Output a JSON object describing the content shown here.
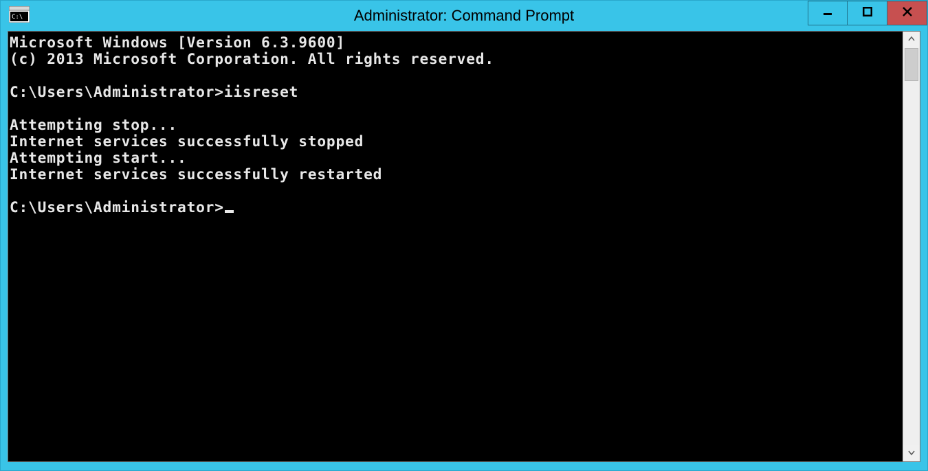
{
  "window": {
    "title": "Administrator: Command Prompt"
  },
  "terminal": {
    "line0": "Microsoft Windows [Version 6.3.9600]",
    "line1": "(c) 2013 Microsoft Corporation. All rights reserved.",
    "line2": "",
    "line3": "C:\\Users\\Administrator>iisreset",
    "line4": "",
    "line5": "Attempting stop...",
    "line6": "Internet services successfully stopped",
    "line7": "Attempting start...",
    "line8": "Internet services successfully restarted",
    "line9": "",
    "line10": "C:\\Users\\Administrator>"
  }
}
